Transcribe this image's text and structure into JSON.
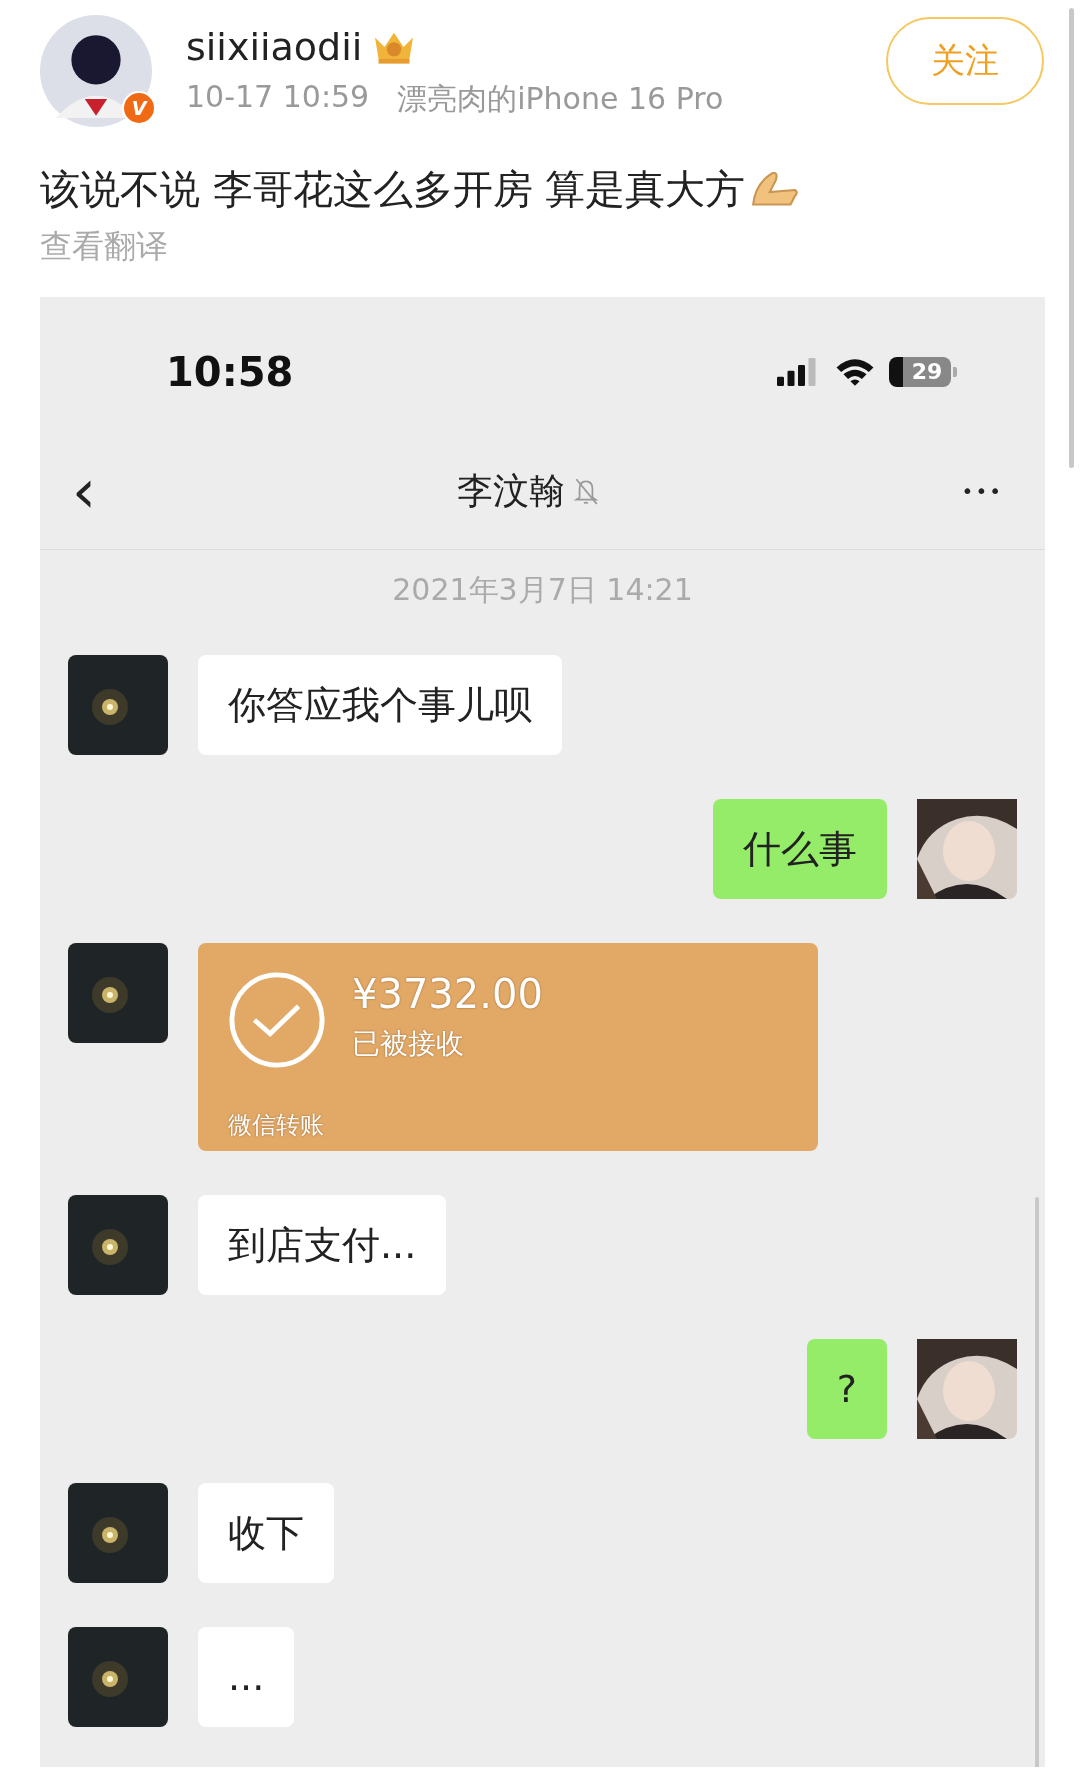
{
  "post": {
    "author": "siixiiaodii",
    "verified_badge": "V",
    "time": "10-17 10:59",
    "device": "漂亮肉的iPhone 16 Pro",
    "follow_button": "关注",
    "text": "该说不说 李哥花这么多开房 算是真大方",
    "translate_link": "查看翻译"
  },
  "screenshot": {
    "status_bar": {
      "time": "10:58",
      "battery": "29"
    },
    "chat_header": {
      "back": "‹",
      "title": "李汶翰",
      "more": "•••",
      "muted": true
    },
    "date": "2021年3月7日 14:21",
    "messages": [
      {
        "kind": "text",
        "outgoing": false,
        "text": "你答应我个事儿呗"
      },
      {
        "kind": "text",
        "outgoing": true,
        "text": "什么事"
      },
      {
        "kind": "transfer",
        "outgoing": false,
        "amount": "¥3732.00",
        "status": "已被接收",
        "label": "微信转账"
      },
      {
        "kind": "text",
        "outgoing": false,
        "text": "到店支付..."
      },
      {
        "kind": "text",
        "outgoing": true,
        "text": "?"
      },
      {
        "kind": "text",
        "outgoing": false,
        "text": "收下"
      },
      {
        "kind": "text",
        "outgoing": false,
        "text": "..."
      }
    ]
  }
}
